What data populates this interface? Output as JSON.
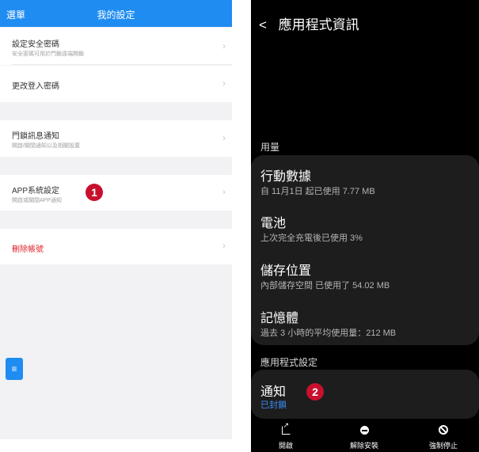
{
  "left": {
    "header": {
      "menu_label": "選單",
      "title": "我的設定"
    },
    "rows": [
      {
        "title": "設定安全密碼",
        "subtitle": "安全密碼可用於門鎖遠端開鎖"
      },
      {
        "title": "更改登入密碼",
        "subtitle": ""
      },
      {
        "title": "門鎖訊息通知",
        "subtitle": "開啟/關閉通知以及相關設置"
      },
      {
        "title": "APP系統設定",
        "subtitle": "開啟或關閉APP通知"
      },
      {
        "title": "刪除帳號",
        "subtitle": ""
      }
    ],
    "chevron": "›",
    "badge": "1",
    "fab_icon": "≡",
    "colors": {
      "accent": "#1f8cf2",
      "danger": "#e0202a",
      "badge": "#c8102e"
    }
  },
  "right": {
    "header": {
      "back": "<",
      "title": "應用程式資訊"
    },
    "usage_label": "用量",
    "usage_items": [
      {
        "title": "行動數據",
        "subtitle": "自 11月1日 起已使用 7.77 MB"
      },
      {
        "title": "電池",
        "subtitle": "上次完全充電後已使用 3%"
      },
      {
        "title": "儲存位置",
        "subtitle": "內部儲存空間 已使用了 54.02 MB"
      },
      {
        "title": "記憶體",
        "subtitle": "過去 3 小時的平均使用量：212 MB"
      }
    ],
    "settings_label": "應用程式設定",
    "notification": {
      "title": "通知",
      "subtitle": "已封鎖"
    },
    "badge": "2",
    "bottom_nav": [
      {
        "label": "開啟",
        "icon": "open-icon"
      },
      {
        "label": "解除安裝",
        "icon": "uninstall-icon"
      },
      {
        "label": "強制停止",
        "icon": "force-stop-icon"
      }
    ]
  }
}
